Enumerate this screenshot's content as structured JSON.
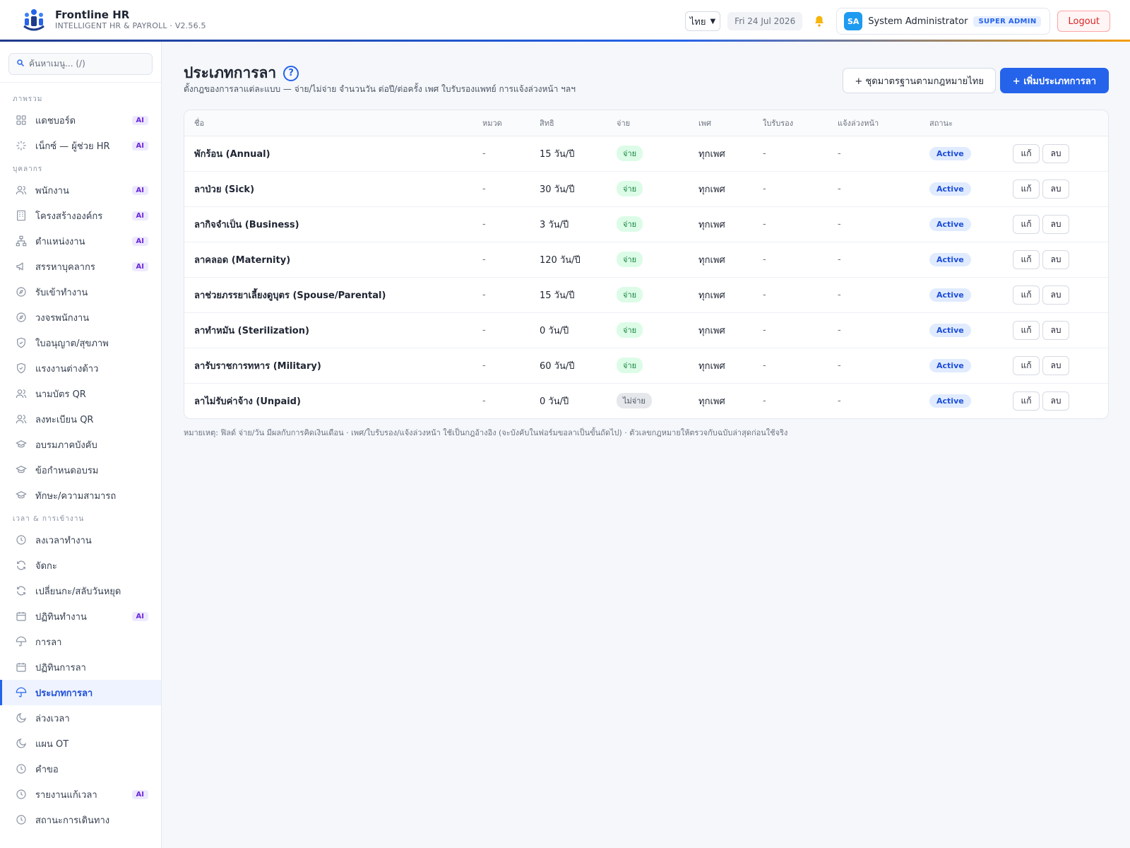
{
  "header": {
    "brand_name": "Frontline HR",
    "brand_sub": "INTELLIGENT HR & PAYROLL · V2.56.5",
    "language": "ไทย",
    "date": "Fri 24 Jul 2026",
    "user_initials": "SA",
    "user_name": "System Administrator",
    "role": "SUPER ADMIN",
    "logout_label": "Logout"
  },
  "sidebar": {
    "search_placeholder": "ค้นหาเมนู... (/)",
    "sections": [
      {
        "title": "ภาพรวม",
        "items": [
          {
            "label": "แดชบอร์ด",
            "icon": "grid-icon",
            "ai": "AI"
          },
          {
            "label": "เน็กซ์ — ผู้ช่วย HR",
            "icon": "sparkle-icon",
            "ai": "AI"
          }
        ]
      },
      {
        "title": "บุคลากร",
        "items": [
          {
            "label": "พนักงาน",
            "icon": "users-icon",
            "ai": "AI"
          },
          {
            "label": "โครงสร้างองค์กร",
            "icon": "building-icon",
            "ai": "AI"
          },
          {
            "label": "ตำแหน่งงาน",
            "icon": "org-chart-icon",
            "ai": "AI"
          },
          {
            "label": "สรรหาบุคลากร",
            "icon": "megaphone-icon",
            "ai": "AI"
          },
          {
            "label": "รับเข้าทำงาน",
            "icon": "compass-icon",
            "ai": ""
          },
          {
            "label": "วงจรพนักงาน",
            "icon": "compass-icon",
            "ai": ""
          },
          {
            "label": "ใบอนุญาต/สุขภาพ",
            "icon": "shield-icon",
            "ai": ""
          },
          {
            "label": "แรงงานต่างด้าว",
            "icon": "shield-icon",
            "ai": ""
          },
          {
            "label": "นามบัตร QR",
            "icon": "users-icon",
            "ai": ""
          },
          {
            "label": "ลงทะเบียน QR",
            "icon": "users-icon",
            "ai": ""
          },
          {
            "label": "อบรมภาคบังคับ",
            "icon": "graduation-cap-icon",
            "ai": ""
          },
          {
            "label": "ข้อกำหนดอบรม",
            "icon": "graduation-cap-icon",
            "ai": ""
          },
          {
            "label": "ทักษะ/ความสามารถ",
            "icon": "graduation-cap-icon",
            "ai": ""
          }
        ]
      },
      {
        "title": "เวลา & การเข้างาน",
        "items": [
          {
            "label": "ลงเวลาทำงาน",
            "icon": "clock-icon",
            "ai": ""
          },
          {
            "label": "จัดกะ",
            "icon": "refresh-icon",
            "ai": ""
          },
          {
            "label": "เปลี่ยนกะ/สลับวันหยุด",
            "icon": "refresh-icon",
            "ai": ""
          },
          {
            "label": "ปฏิทินทำงาน",
            "icon": "calendar-icon",
            "ai": "AI"
          },
          {
            "label": "การลา",
            "icon": "umbrella-icon",
            "ai": ""
          },
          {
            "label": "ปฏิทินการลา",
            "icon": "calendar-icon",
            "ai": ""
          },
          {
            "label": "ประเภทการลา",
            "icon": "umbrella-icon",
            "ai": "",
            "active": true
          },
          {
            "label": "ล่วงเวลา",
            "icon": "moon-icon",
            "ai": ""
          },
          {
            "label": "แผน OT",
            "icon": "moon-icon",
            "ai": ""
          },
          {
            "label": "คำขอ",
            "icon": "clock-icon",
            "ai": ""
          },
          {
            "label": "รายงานแก้เวลา",
            "icon": "clock-icon",
            "ai": "AI"
          },
          {
            "label": "สถานะการเดินทาง",
            "icon": "clock-icon",
            "ai": ""
          }
        ]
      }
    ]
  },
  "main": {
    "title": "ประเภทการลา",
    "subtitle": "ตั้งกฎของการลาแต่ละแบบ — จ่าย/ไม่จ่าย จำนวนวัน ต่อปี/ต่อครั้ง เพศ ใบรับรองแพทย์ การแจ้งล่วงหน้า ฯลฯ",
    "btn_thai_standard": "+ ชุดมาตรฐานตามกฎหมายไทย",
    "btn_add": "+ เพิ่มประเภทการลา",
    "columns": [
      "ชื่อ",
      "หมวด",
      "สิทธิ",
      "จ่าย",
      "เพศ",
      "ใบรับรอง",
      "แจ้งล่วงหน้า",
      "สถานะ",
      ""
    ],
    "rows": [
      {
        "name": "พักร้อน (Annual)",
        "category": "-",
        "entitlement": "15 วัน/ปี",
        "paid": "จ่าย",
        "paid_flag": true,
        "gender": "ทุกเพศ",
        "certificate": "-",
        "notice": "-",
        "status": "Active"
      },
      {
        "name": "ลาป่วย (Sick)",
        "category": "-",
        "entitlement": "30 วัน/ปี",
        "paid": "จ่าย",
        "paid_flag": true,
        "gender": "ทุกเพศ",
        "certificate": "-",
        "notice": "-",
        "status": "Active"
      },
      {
        "name": "ลากิจจำเป็น (Business)",
        "category": "-",
        "entitlement": "3 วัน/ปี",
        "paid": "จ่าย",
        "paid_flag": true,
        "gender": "ทุกเพศ",
        "certificate": "-",
        "notice": "-",
        "status": "Active"
      },
      {
        "name": "ลาคลอด (Maternity)",
        "category": "-",
        "entitlement": "120 วัน/ปี",
        "paid": "จ่าย",
        "paid_flag": true,
        "gender": "ทุกเพศ",
        "certificate": "-",
        "notice": "-",
        "status": "Active"
      },
      {
        "name": "ลาช่วยภรรยาเลี้ยงดูบุตร (Spouse/Parental)",
        "category": "-",
        "entitlement": "15 วัน/ปี",
        "paid": "จ่าย",
        "paid_flag": true,
        "gender": "ทุกเพศ",
        "certificate": "-",
        "notice": "-",
        "status": "Active"
      },
      {
        "name": "ลาทำหมัน (Sterilization)",
        "category": "-",
        "entitlement": "0 วัน/ปี",
        "paid": "จ่าย",
        "paid_flag": true,
        "gender": "ทุกเพศ",
        "certificate": "-",
        "notice": "-",
        "status": "Active"
      },
      {
        "name": "ลารับราชการทหาร (Military)",
        "category": "-",
        "entitlement": "60 วัน/ปี",
        "paid": "จ่าย",
        "paid_flag": true,
        "gender": "ทุกเพศ",
        "certificate": "-",
        "notice": "-",
        "status": "Active"
      },
      {
        "name": "ลาไม่รับค่าจ้าง (Unpaid)",
        "category": "-",
        "entitlement": "0 วัน/ปี",
        "paid": "ไม่จ่าย",
        "paid_flag": false,
        "gender": "ทุกเพศ",
        "certificate": "-",
        "notice": "-",
        "status": "Active"
      }
    ],
    "edit_label": "แก้",
    "delete_label": "ลบ",
    "footnote": "หมายเหตุ: ฟิลด์ จ่าย/วัน มีผลกับการคิดเงินเดือน · เพศ/ใบรับรอง/แจ้งล่วงหน้า ใช้เป็นกฎอ้างอิง (จะบังคับในฟอร์มขอลาเป็นขั้นถัดไป) · ตัวเลขกฎหมายให้ตรวจกับฉบับล่าสุดก่อนใช้จริง"
  },
  "colors": {
    "primary": "#2563eb",
    "active_nav_bg": "#eef3ff",
    "paid_pill": "#dcfce7",
    "unpaid_pill": "#e5e7eb",
    "logout": "#dc2626",
    "ai_badge": "#ede9fe"
  }
}
